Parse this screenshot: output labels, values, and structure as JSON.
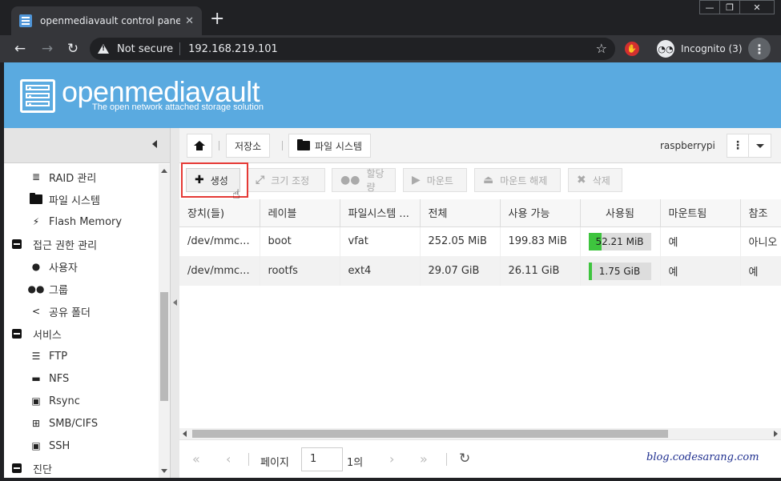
{
  "browser": {
    "tab_title": "openmediavault control panel - r",
    "tab_close": "✕",
    "new_tab": "+",
    "window_controls": [
      "—",
      "❐",
      "✕"
    ],
    "not_secure": "Not secure",
    "url": "192.168.219.101",
    "incognito_label": "Incognito (3)"
  },
  "header": {
    "title": "openmediavault",
    "subtitle": "The open network attached storage solution"
  },
  "nav": {
    "items": [
      {
        "label": "RAID 관리",
        "icon": "database-icon"
      },
      {
        "label": "파일 시스템",
        "icon": "folder-icon"
      },
      {
        "label": "Flash Memory",
        "icon": "bolt-icon"
      },
      {
        "label": "접근 권한 관리",
        "icon": "minus-square-icon"
      },
      {
        "label": "사용자",
        "icon": "user-icon"
      },
      {
        "label": "그룹",
        "icon": "users-icon"
      },
      {
        "label": "공유 폴더",
        "icon": "share-icon"
      },
      {
        "label": "서비스",
        "icon": "minus-square-icon"
      },
      {
        "label": "FTP",
        "icon": "server-icon"
      },
      {
        "label": "NFS",
        "icon": "monitor-icon"
      },
      {
        "label": "Rsync",
        "icon": "sitemap-icon"
      },
      {
        "label": "SMB/CIFS",
        "icon": "windows-icon"
      },
      {
        "label": "SSH",
        "icon": "terminal-icon"
      },
      {
        "label": "진단",
        "icon": "minus-square-icon"
      }
    ]
  },
  "breadcrumb": {
    "storage": "저장소",
    "filesystems": "파일 시스템",
    "hostname": "raspberrypi",
    "kebab": "⋮"
  },
  "actions": {
    "create": "생성",
    "resize": "크기 조정",
    "quota": "할당량",
    "mount": "마운트",
    "unmount": "마운트 해제",
    "delete": "삭제"
  },
  "grid": {
    "columns": [
      "장치(들)",
      "레이블",
      "파일시스템 ...",
      "전체",
      "사용 가능",
      "사용됨",
      "마운트됨",
      "참조"
    ],
    "rows": [
      {
        "device": "/dev/mmc...",
        "label": "boot",
        "fs": "vfat",
        "total": "252.05 MiB",
        "available": "199.83 MiB",
        "used": "52.21 MiB",
        "used_pct": 0.21,
        "mounted": "예",
        "referenced": "아니오"
      },
      {
        "device": "/dev/mmc...",
        "label": "rootfs",
        "fs": "ext4",
        "total": "29.07 GiB",
        "available": "26.11 GiB",
        "used": "1.75 GiB",
        "used_pct": 0.06,
        "mounted": "예",
        "referenced": "예"
      }
    ]
  },
  "pager": {
    "page_label": "페이지",
    "page_value": "1",
    "of_label": "1의"
  },
  "watermark": "blog.codesarang.com",
  "colors": {
    "header_blue": "#5aaae0",
    "usage_green": "#3ec43e",
    "highlight_red": "#e53935"
  }
}
